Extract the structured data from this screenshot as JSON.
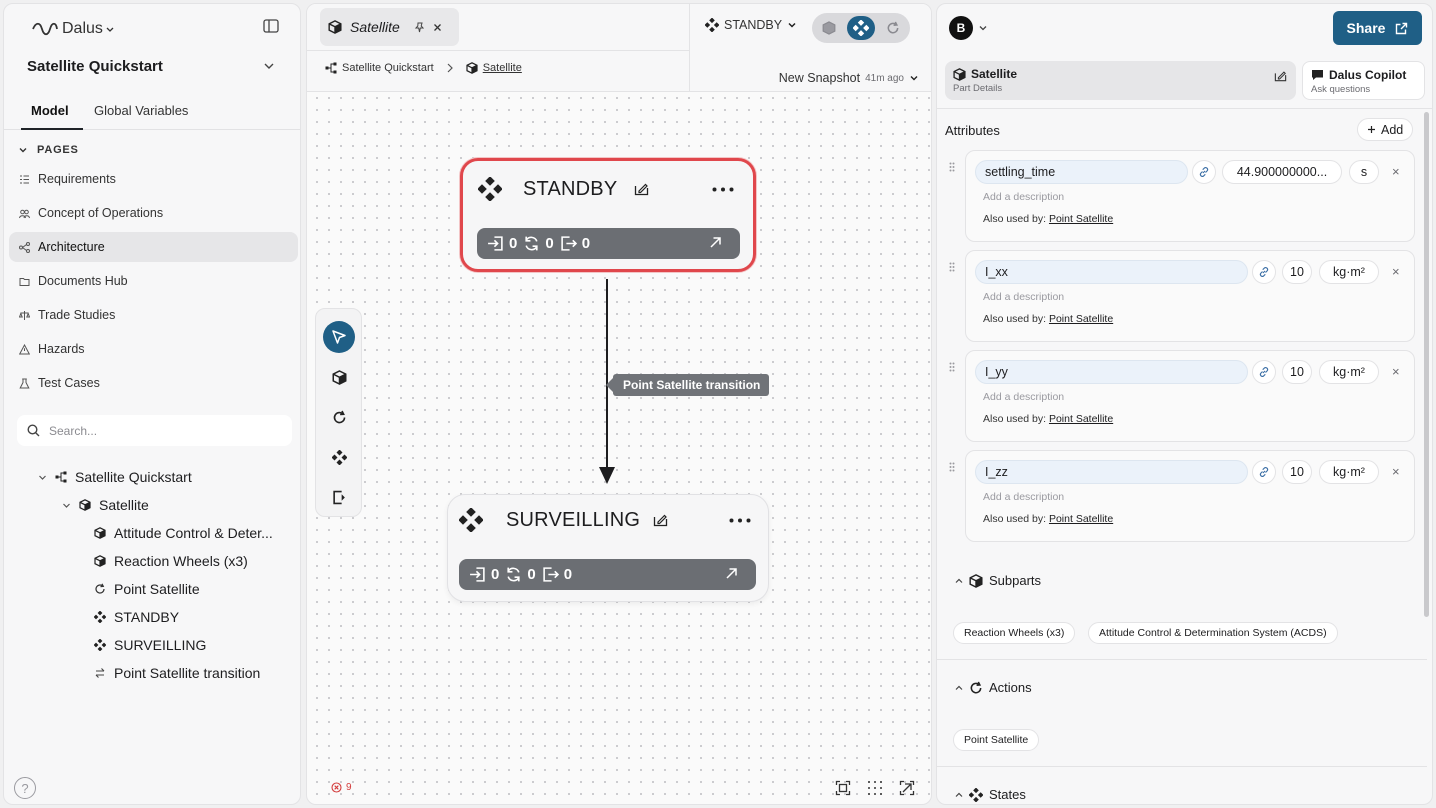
{
  "app": {
    "name": "Dalus"
  },
  "sidebar": {
    "project_title": "Satellite Quickstart",
    "tabs": [
      {
        "label": "Model"
      },
      {
        "label": "Global Variables"
      }
    ],
    "pages_header": "PAGES",
    "pages": [
      {
        "label": "Requirements",
        "icon": "list-icon"
      },
      {
        "label": "Concept of Operations",
        "icon": "people-icon"
      },
      {
        "label": "Architecture",
        "icon": "diagram-icon"
      },
      {
        "label": "Documents Hub",
        "icon": "folder-icon"
      },
      {
        "label": "Trade Studies",
        "icon": "scale-icon"
      },
      {
        "label": "Hazards",
        "icon": "warning-icon"
      },
      {
        "label": "Test Cases",
        "icon": "flask-icon"
      }
    ],
    "search_placeholder": "Search...",
    "tree": [
      {
        "label": "Satellite Quickstart",
        "icon": "hierarchy-icon"
      },
      {
        "label": "Satellite",
        "icon": "cube-icon"
      },
      {
        "label": "Attitude Control & Deter...",
        "icon": "cube-icon"
      },
      {
        "label": "Reaction Wheels (x3)",
        "icon": "cube-icon"
      },
      {
        "label": "Point Satellite",
        "icon": "refresh-icon"
      },
      {
        "label": "STANDBY",
        "icon": "state-icon"
      },
      {
        "label": "SURVEILLING",
        "icon": "state-icon"
      },
      {
        "label": "Point Satellite transition",
        "icon": "transition-icon"
      }
    ],
    "help": "?"
  },
  "canvas": {
    "tab_label": "Satellite",
    "breadcrumb": [
      "Satellite Quickstart",
      "Satellite"
    ],
    "state_select": "STANDBY",
    "snapshot_label": "New Snapshot",
    "snapshot_ago": "41m ago",
    "nodes": [
      {
        "title": "STANDBY",
        "entry": "0",
        "do": "0",
        "exit": "0"
      },
      {
        "title": "SURVEILLING",
        "entry": "0",
        "do": "0",
        "exit": "0"
      }
    ],
    "transition_label": "Point Satellite transition",
    "error_count": "9"
  },
  "panel": {
    "avatar": "B",
    "share_label": "Share",
    "tabs": [
      {
        "title": "Satellite",
        "subtitle": "Part Details"
      },
      {
        "title": "Dalus Copilot",
        "subtitle": "Ask questions"
      }
    ],
    "attributes_heading": "Attributes",
    "add_label": "Add",
    "description_placeholder": "Add a description",
    "used_by_prefix": "Also used by:",
    "attributes": [
      {
        "name": "settling_time",
        "value": "44.900000000...",
        "unit": "s",
        "used_by": "Point Satellite"
      },
      {
        "name": "I_xx",
        "value": "10",
        "unit": "kg·m²",
        "used_by": "Point Satellite"
      },
      {
        "name": "I_yy",
        "value": "10",
        "unit": "kg·m²",
        "used_by": "Point Satellite"
      },
      {
        "name": "I_zz",
        "value": "10",
        "unit": "kg·m²",
        "used_by": "Point Satellite"
      }
    ],
    "subparts_heading": "Subparts",
    "subparts": [
      "Reaction Wheels (x3)",
      "Attitude Control & Determination System (ACDS)"
    ],
    "actions_heading": "Actions",
    "actions": [
      "Point Satellite"
    ],
    "states_heading": "States"
  },
  "colors": {
    "accent": "#1f5f86",
    "highlight": "#e0474c",
    "error": "#d33c3c"
  }
}
